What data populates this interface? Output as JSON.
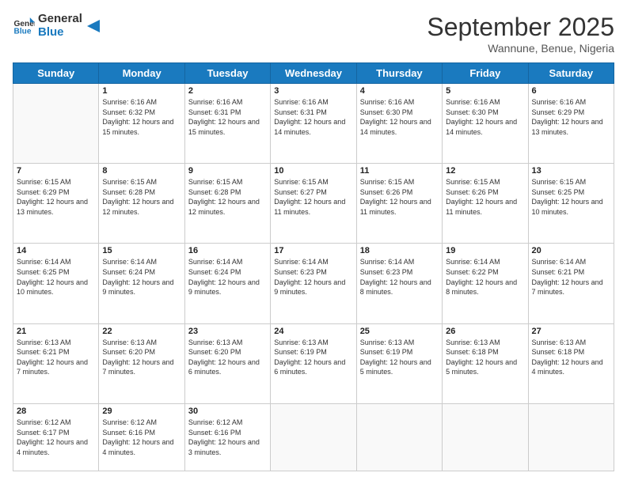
{
  "logo": {
    "text_general": "General",
    "text_blue": "Blue"
  },
  "header": {
    "month": "September 2025",
    "location": "Wannune, Benue, Nigeria"
  },
  "days_of_week": [
    "Sunday",
    "Monday",
    "Tuesday",
    "Wednesday",
    "Thursday",
    "Friday",
    "Saturday"
  ],
  "weeks": [
    [
      {
        "day": "",
        "sunrise": "",
        "sunset": "",
        "daylight": ""
      },
      {
        "day": "1",
        "sunrise": "Sunrise: 6:16 AM",
        "sunset": "Sunset: 6:32 PM",
        "daylight": "Daylight: 12 hours and 15 minutes."
      },
      {
        "day": "2",
        "sunrise": "Sunrise: 6:16 AM",
        "sunset": "Sunset: 6:31 PM",
        "daylight": "Daylight: 12 hours and 15 minutes."
      },
      {
        "day": "3",
        "sunrise": "Sunrise: 6:16 AM",
        "sunset": "Sunset: 6:31 PM",
        "daylight": "Daylight: 12 hours and 14 minutes."
      },
      {
        "day": "4",
        "sunrise": "Sunrise: 6:16 AM",
        "sunset": "Sunset: 6:30 PM",
        "daylight": "Daylight: 12 hours and 14 minutes."
      },
      {
        "day": "5",
        "sunrise": "Sunrise: 6:16 AM",
        "sunset": "Sunset: 6:30 PM",
        "daylight": "Daylight: 12 hours and 14 minutes."
      },
      {
        "day": "6",
        "sunrise": "Sunrise: 6:16 AM",
        "sunset": "Sunset: 6:29 PM",
        "daylight": "Daylight: 12 hours and 13 minutes."
      }
    ],
    [
      {
        "day": "7",
        "sunrise": "Sunrise: 6:15 AM",
        "sunset": "Sunset: 6:29 PM",
        "daylight": "Daylight: 12 hours and 13 minutes."
      },
      {
        "day": "8",
        "sunrise": "Sunrise: 6:15 AM",
        "sunset": "Sunset: 6:28 PM",
        "daylight": "Daylight: 12 hours and 12 minutes."
      },
      {
        "day": "9",
        "sunrise": "Sunrise: 6:15 AM",
        "sunset": "Sunset: 6:28 PM",
        "daylight": "Daylight: 12 hours and 12 minutes."
      },
      {
        "day": "10",
        "sunrise": "Sunrise: 6:15 AM",
        "sunset": "Sunset: 6:27 PM",
        "daylight": "Daylight: 12 hours and 11 minutes."
      },
      {
        "day": "11",
        "sunrise": "Sunrise: 6:15 AM",
        "sunset": "Sunset: 6:26 PM",
        "daylight": "Daylight: 12 hours and 11 minutes."
      },
      {
        "day": "12",
        "sunrise": "Sunrise: 6:15 AM",
        "sunset": "Sunset: 6:26 PM",
        "daylight": "Daylight: 12 hours and 11 minutes."
      },
      {
        "day": "13",
        "sunrise": "Sunrise: 6:15 AM",
        "sunset": "Sunset: 6:25 PM",
        "daylight": "Daylight: 12 hours and 10 minutes."
      }
    ],
    [
      {
        "day": "14",
        "sunrise": "Sunrise: 6:14 AM",
        "sunset": "Sunset: 6:25 PM",
        "daylight": "Daylight: 12 hours and 10 minutes."
      },
      {
        "day": "15",
        "sunrise": "Sunrise: 6:14 AM",
        "sunset": "Sunset: 6:24 PM",
        "daylight": "Daylight: 12 hours and 9 minutes."
      },
      {
        "day": "16",
        "sunrise": "Sunrise: 6:14 AM",
        "sunset": "Sunset: 6:24 PM",
        "daylight": "Daylight: 12 hours and 9 minutes."
      },
      {
        "day": "17",
        "sunrise": "Sunrise: 6:14 AM",
        "sunset": "Sunset: 6:23 PM",
        "daylight": "Daylight: 12 hours and 9 minutes."
      },
      {
        "day": "18",
        "sunrise": "Sunrise: 6:14 AM",
        "sunset": "Sunset: 6:23 PM",
        "daylight": "Daylight: 12 hours and 8 minutes."
      },
      {
        "day": "19",
        "sunrise": "Sunrise: 6:14 AM",
        "sunset": "Sunset: 6:22 PM",
        "daylight": "Daylight: 12 hours and 8 minutes."
      },
      {
        "day": "20",
        "sunrise": "Sunrise: 6:14 AM",
        "sunset": "Sunset: 6:21 PM",
        "daylight": "Daylight: 12 hours and 7 minutes."
      }
    ],
    [
      {
        "day": "21",
        "sunrise": "Sunrise: 6:13 AM",
        "sunset": "Sunset: 6:21 PM",
        "daylight": "Daylight: 12 hours and 7 minutes."
      },
      {
        "day": "22",
        "sunrise": "Sunrise: 6:13 AM",
        "sunset": "Sunset: 6:20 PM",
        "daylight": "Daylight: 12 hours and 7 minutes."
      },
      {
        "day": "23",
        "sunrise": "Sunrise: 6:13 AM",
        "sunset": "Sunset: 6:20 PM",
        "daylight": "Daylight: 12 hours and 6 minutes."
      },
      {
        "day": "24",
        "sunrise": "Sunrise: 6:13 AM",
        "sunset": "Sunset: 6:19 PM",
        "daylight": "Daylight: 12 hours and 6 minutes."
      },
      {
        "day": "25",
        "sunrise": "Sunrise: 6:13 AM",
        "sunset": "Sunset: 6:19 PM",
        "daylight": "Daylight: 12 hours and 5 minutes."
      },
      {
        "day": "26",
        "sunrise": "Sunrise: 6:13 AM",
        "sunset": "Sunset: 6:18 PM",
        "daylight": "Daylight: 12 hours and 5 minutes."
      },
      {
        "day": "27",
        "sunrise": "Sunrise: 6:13 AM",
        "sunset": "Sunset: 6:18 PM",
        "daylight": "Daylight: 12 hours and 4 minutes."
      }
    ],
    [
      {
        "day": "28",
        "sunrise": "Sunrise: 6:12 AM",
        "sunset": "Sunset: 6:17 PM",
        "daylight": "Daylight: 12 hours and 4 minutes."
      },
      {
        "day": "29",
        "sunrise": "Sunrise: 6:12 AM",
        "sunset": "Sunset: 6:16 PM",
        "daylight": "Daylight: 12 hours and 4 minutes."
      },
      {
        "day": "30",
        "sunrise": "Sunrise: 6:12 AM",
        "sunset": "Sunset: 6:16 PM",
        "daylight": "Daylight: 12 hours and 3 minutes."
      },
      {
        "day": "",
        "sunrise": "",
        "sunset": "",
        "daylight": ""
      },
      {
        "day": "",
        "sunrise": "",
        "sunset": "",
        "daylight": ""
      },
      {
        "day": "",
        "sunrise": "",
        "sunset": "",
        "daylight": ""
      },
      {
        "day": "",
        "sunrise": "",
        "sunset": "",
        "daylight": ""
      }
    ]
  ]
}
